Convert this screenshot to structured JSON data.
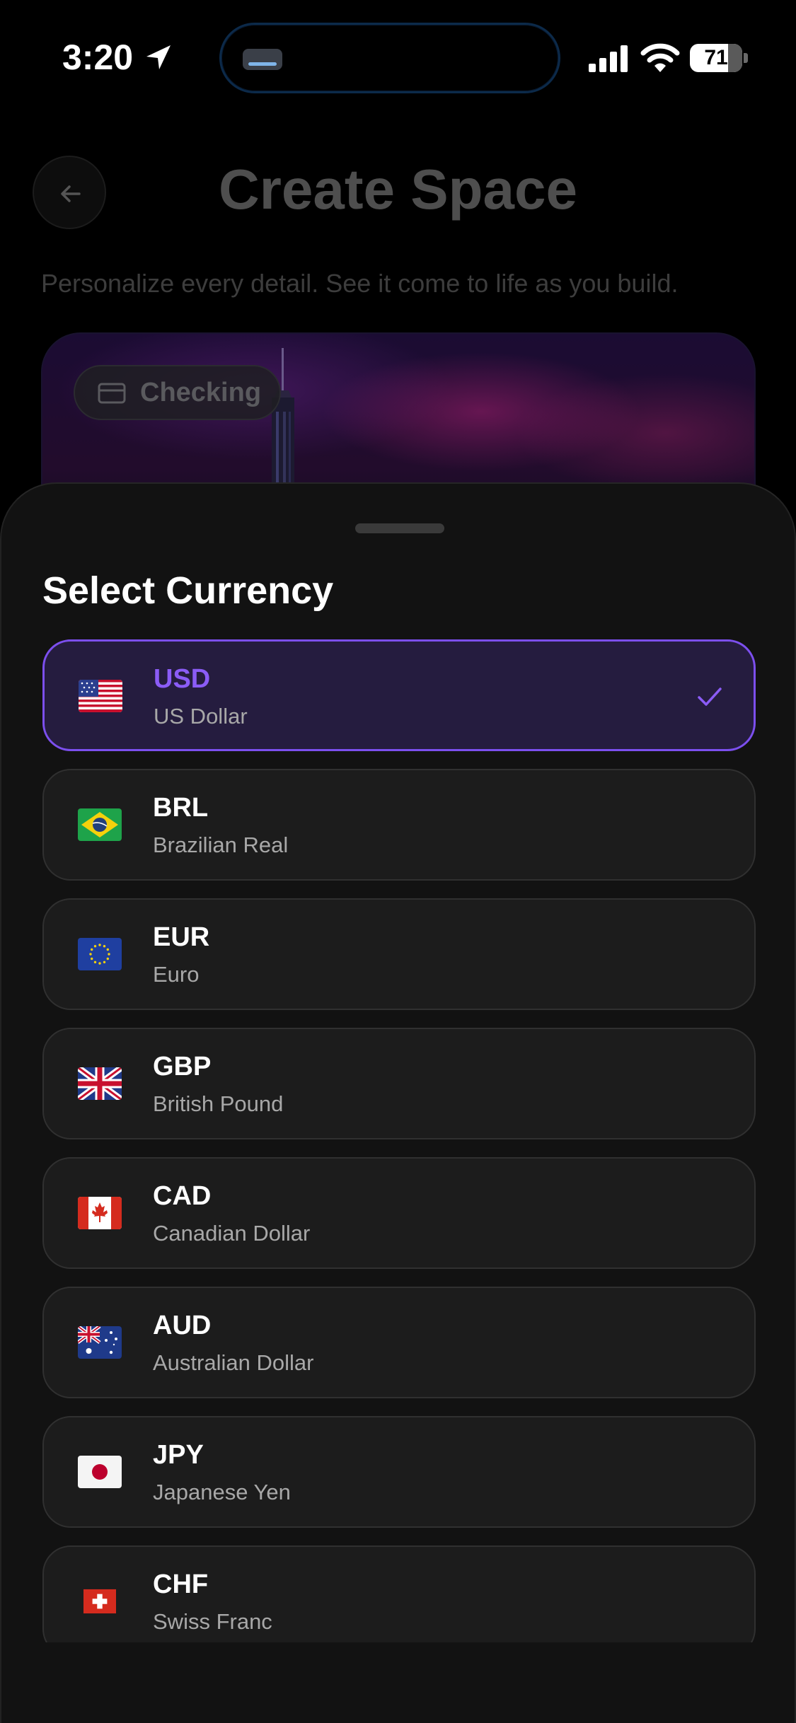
{
  "status_bar": {
    "time": "3:20",
    "battery": "71"
  },
  "background": {
    "title": "Create Space",
    "subtitle": "Personalize every detail. See it come to life as you build.",
    "tag_label": "Checking"
  },
  "sheet": {
    "title": "Select Currency",
    "selected_code": "USD",
    "accent_color": "#8b5cf6",
    "currencies": [
      {
        "code": "USD",
        "name": "US Dollar",
        "flag": "us-flag-icon"
      },
      {
        "code": "BRL",
        "name": "Brazilian Real",
        "flag": "brazil-flag-icon"
      },
      {
        "code": "EUR",
        "name": "Euro",
        "flag": "eu-flag-icon"
      },
      {
        "code": "GBP",
        "name": "British Pound",
        "flag": "uk-flag-icon"
      },
      {
        "code": "CAD",
        "name": "Canadian Dollar",
        "flag": "canada-flag-icon"
      },
      {
        "code": "AUD",
        "name": "Australian Dollar",
        "flag": "australia-flag-icon"
      },
      {
        "code": "JPY",
        "name": "Japanese Yen",
        "flag": "japan-flag-icon"
      },
      {
        "code": "CHF",
        "name": "Swiss Franc",
        "flag": "switzerland-flag-icon"
      }
    ]
  }
}
